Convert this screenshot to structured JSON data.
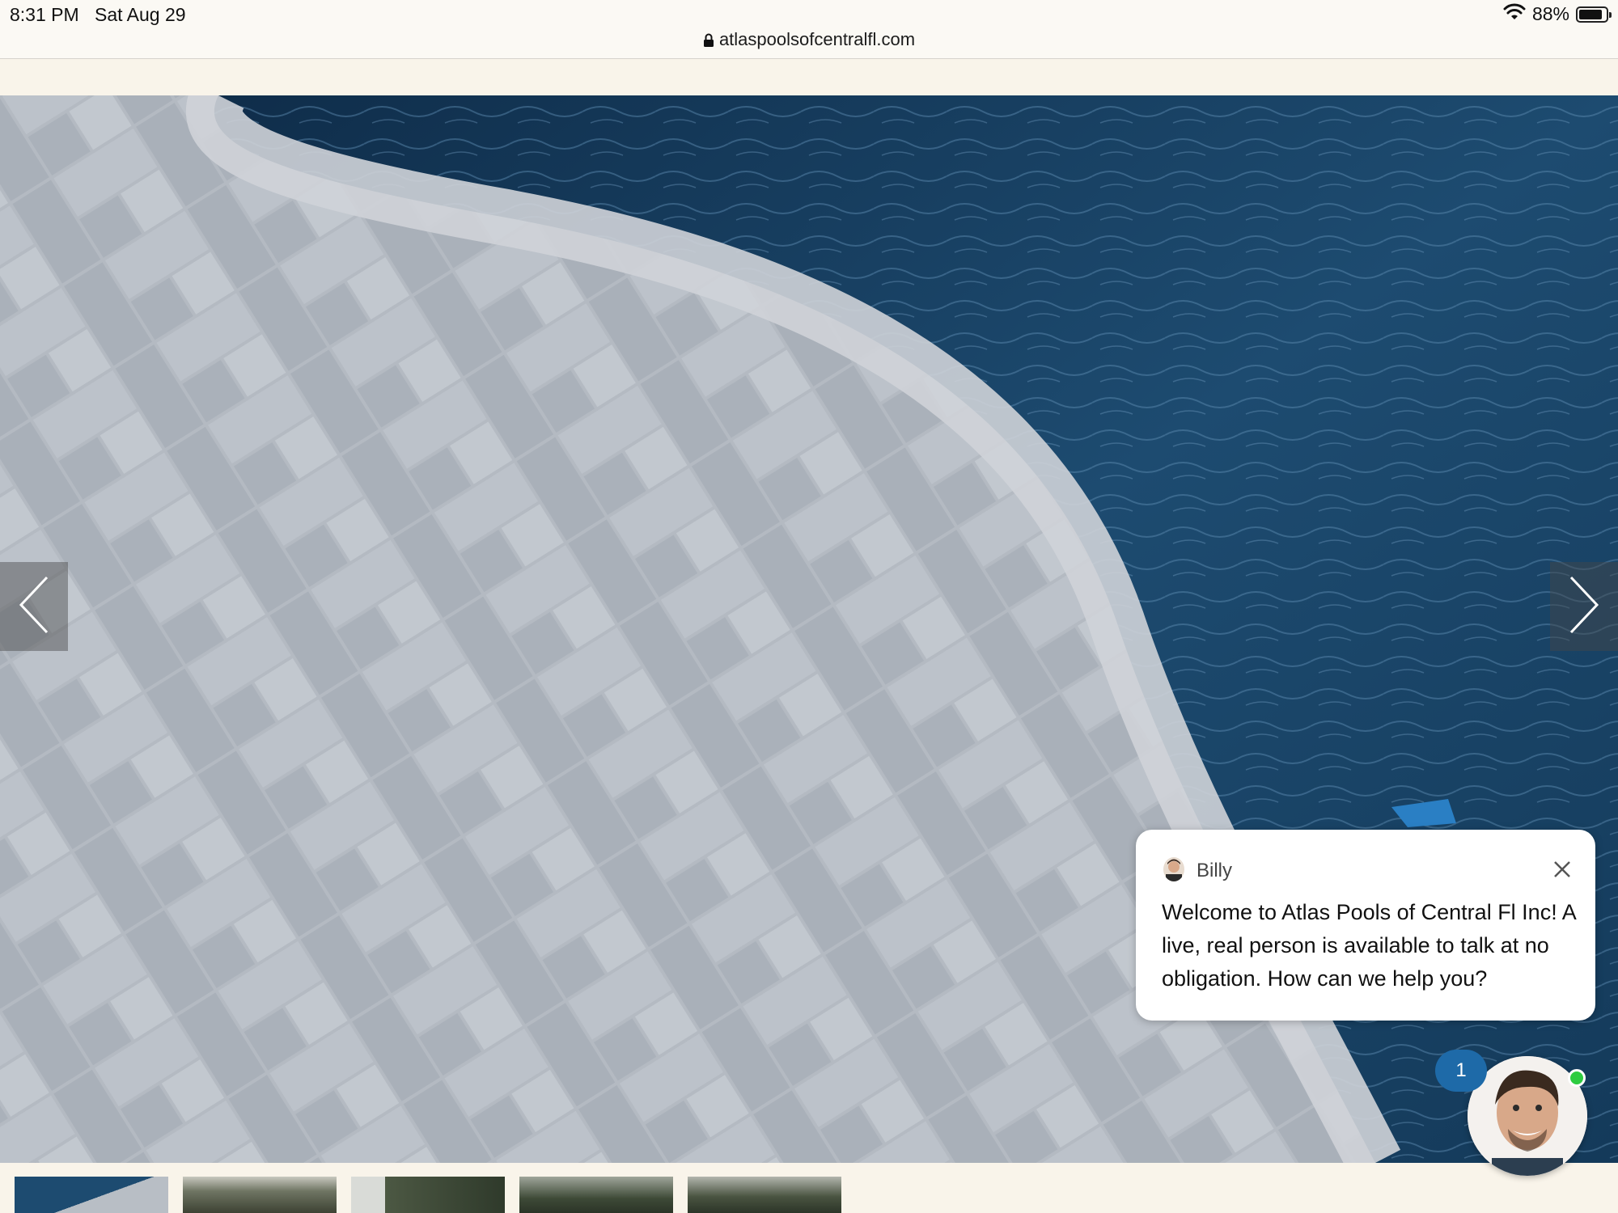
{
  "status_bar": {
    "time": "8:31 PM",
    "date": "Sat Aug 29",
    "battery_percent": "88%",
    "battery_level": 0.88,
    "icons": [
      "wifi-icon",
      "battery-icon"
    ]
  },
  "browser": {
    "url": "atlaspoolsofcentralfl.com",
    "icons": [
      "lock-icon"
    ]
  },
  "carousel": {
    "hero_image": "pool-deck-pavers",
    "prev_icon": "chevron-left-icon",
    "next_icon": "chevron-right-icon",
    "thumbnail_count": 5
  },
  "chat": {
    "agent_name": "Billy",
    "message": "Welcome to Atlas Pools of Central Fl Inc! A live, real person is available to talk at no obligation. How can we help you?",
    "unread_count": "1",
    "colors": {
      "badge": "#1e6aa8",
      "online": "#2ecc40"
    },
    "icons": [
      "close-icon",
      "avatar"
    ]
  }
}
